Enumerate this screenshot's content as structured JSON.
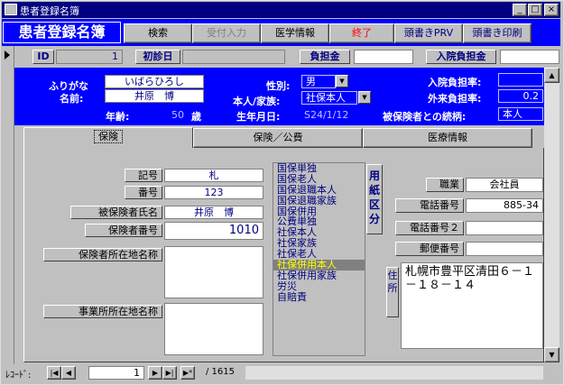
{
  "window": {
    "title": "患者登録名簿"
  },
  "form": {
    "title": "患者登録名簿"
  },
  "toolbar": {
    "buttons": [
      "検索",
      "受付入力",
      "医学情報",
      "終了",
      "頭書きPRV",
      "頭書き印刷"
    ],
    "disabled_color": "#808080",
    "exit_color": "#ff0000"
  },
  "header": {
    "id_label": "ID",
    "id_value": "1",
    "first_visit_label": "初診日",
    "first_visit_value": "",
    "burden_label": "負担金",
    "burden_value": "",
    "inpatient_burden_label": "入院負担金",
    "inpatient_burden_value": ""
  },
  "patient": {
    "furigana_label": "ふりがな",
    "furigana_value": "いばらひろし",
    "name_label": "名前:",
    "name_value": "井原　博",
    "age_label": "年齢:",
    "age_value": "50",
    "age_unit": "歳",
    "gender_label": "性別:",
    "gender_value": "男",
    "family_label": "本人/家族:",
    "family_value": "社保本人",
    "birth_label": "生年月日:",
    "birth_value": "S24/1/12",
    "inpatient_rate_label": "入院負担率:",
    "inpatient_rate_value": "",
    "outpatient_rate_label": "外来負担率:",
    "outpatient_rate_value": "0.2",
    "relation_label": "被保険者との続柄:",
    "relation_value": "本人"
  },
  "tabs": [
    "保険",
    "保険／公費",
    "医療情報"
  ],
  "insurance": {
    "symbol_label": "記号",
    "symbol_value": "札",
    "number_label": "番号",
    "number_value": "123",
    "insured_name_label": "被保険者氏名",
    "insured_name_value": "井原　博",
    "insurer_number_label": "保険者番号",
    "insurer_number_value": "1010",
    "insurer_address_label": "保険者所在地名称",
    "insurer_address_value": "",
    "office_address_label": "事業所所在地名称",
    "office_address_value": ""
  },
  "paper_type": {
    "label": "用紙区分",
    "options": [
      "国保単独",
      "国保老人",
      "国保退職本人",
      "国保退職家族",
      "国保併用",
      "公費単独",
      "社保本人",
      "社保家族",
      "社保老人",
      "社保併用本人",
      "社保併用家族",
      "労災",
      "自賠責"
    ],
    "selected": "社保併用本人"
  },
  "contact": {
    "job_label": "職業",
    "job_value": "会社員",
    "phone_label": "電話番号",
    "phone_value": "885-34",
    "phone2_label": "電話番号２",
    "phone2_value": "",
    "postal_label": "郵便番号",
    "postal_value": "",
    "address_label": "住所",
    "address_value": "札幌市豊平区清田６－１－１８－１４"
  },
  "nav": {
    "record_label": "ﾚｺｰﾄﾞ:",
    "current": "1",
    "total": "/ 1615"
  }
}
